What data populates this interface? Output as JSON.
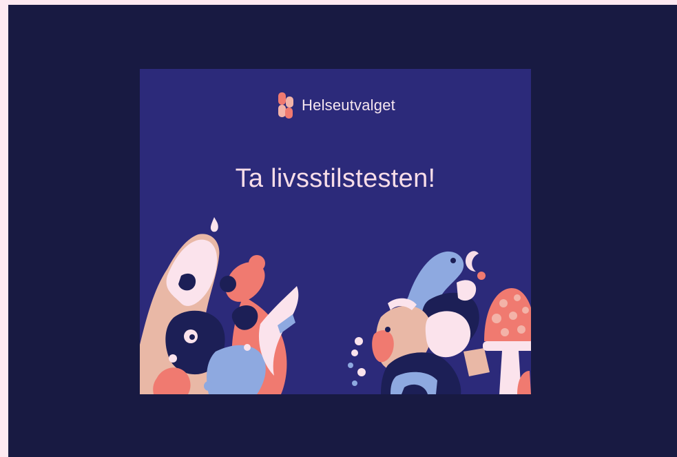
{
  "ad": {
    "brand_name": "Helseutvalget",
    "headline": "Ta livsstilstesten!",
    "logo_icon": "helseutvalget-logo-icon",
    "illustration_icon": "creatures-illustration-icon"
  },
  "colors": {
    "page_background": "#fde9f1",
    "stage_background": "#181a42",
    "ad_background": "#2c2a7a",
    "text": "#f7dde8",
    "accent_coral": "#f07a70"
  }
}
